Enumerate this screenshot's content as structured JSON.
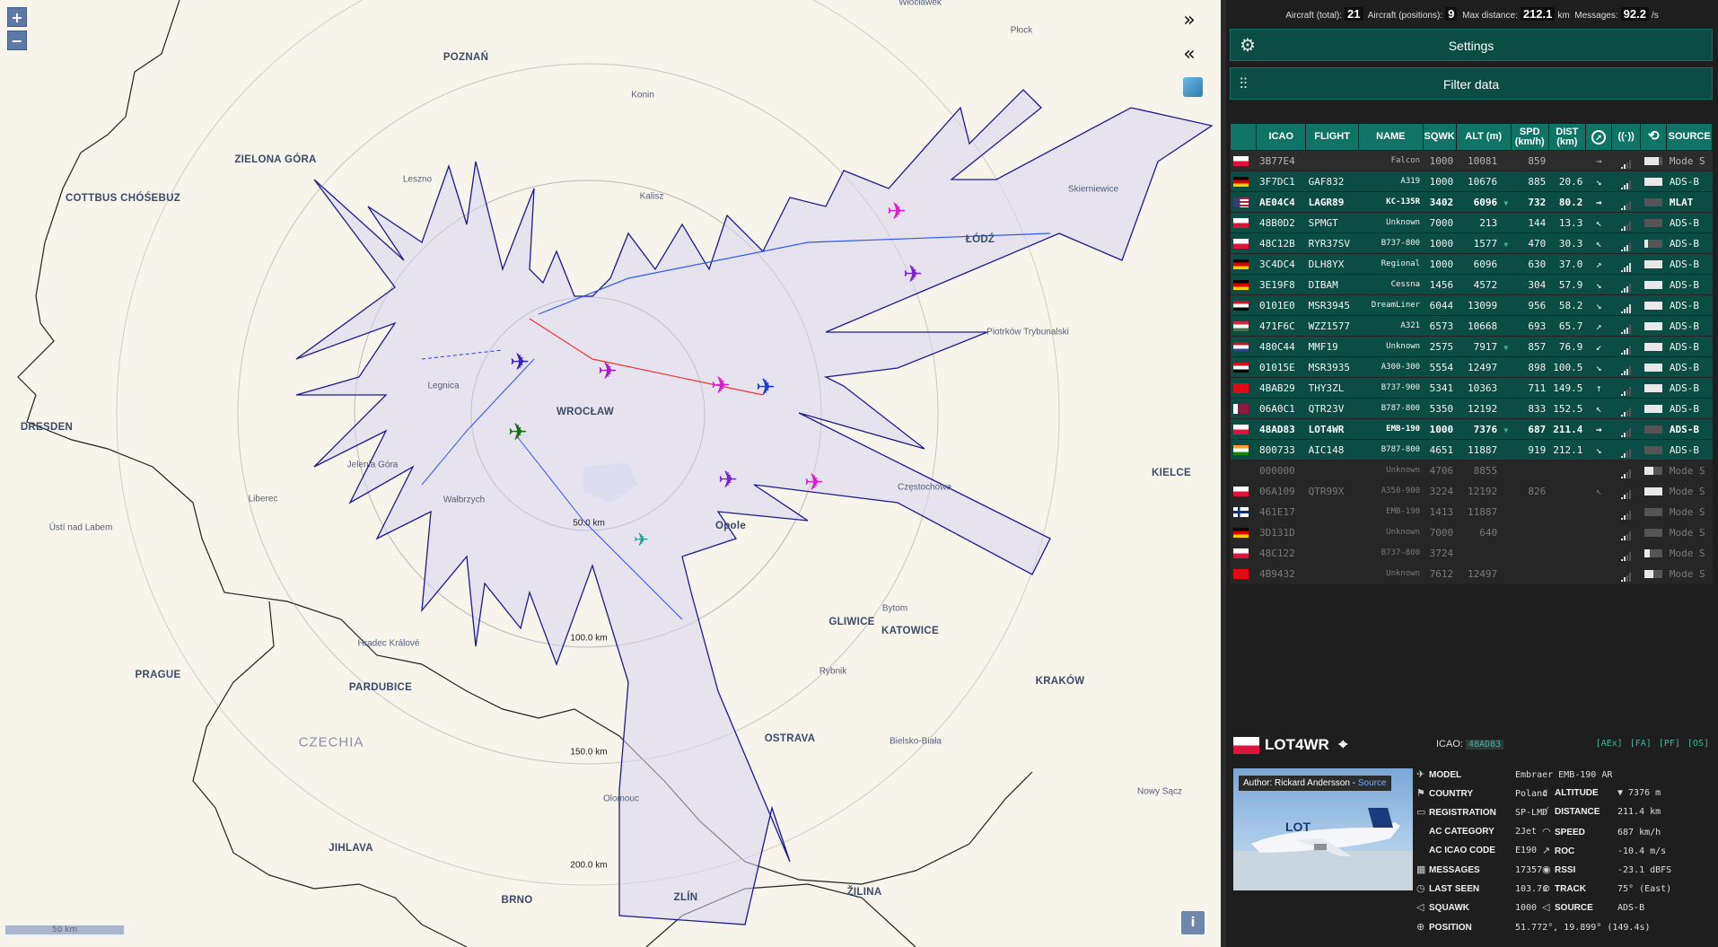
{
  "map": {
    "cities": [
      {
        "name": "POZNAŃ",
        "cls": "big"
      },
      {
        "name": "ZIELONA GÓRA",
        "cls": "big"
      },
      {
        "name": "COTTBUS CHÓŚEBUZ",
        "cls": "big"
      },
      {
        "name": "Konin",
        "cls": ""
      },
      {
        "name": "Leszno",
        "cls": ""
      },
      {
        "name": "Kalisz",
        "cls": ""
      },
      {
        "name": "Płock",
        "cls": ""
      },
      {
        "name": "Skierniewice",
        "cls": ""
      },
      {
        "name": "ŁÓDŹ",
        "cls": "big"
      },
      {
        "name": "Piotrków Trybunalski",
        "cls": ""
      },
      {
        "name": "Legnica",
        "cls": ""
      },
      {
        "name": "WROCŁAW",
        "cls": "big"
      },
      {
        "name": "DRESDEN",
        "cls": "big"
      },
      {
        "name": "Jelenia Góra",
        "cls": ""
      },
      {
        "name": "Wałbrzych",
        "cls": ""
      },
      {
        "name": "Liberec",
        "cls": ""
      },
      {
        "name": "Ústí nad Labem",
        "cls": ""
      },
      {
        "name": "Opole",
        "cls": "big"
      },
      {
        "name": "Częstochowa",
        "cls": ""
      },
      {
        "name": "KIELCE",
        "cls": "big"
      },
      {
        "name": "Bytom",
        "cls": ""
      },
      {
        "name": "GLIWICE",
        "cls": "big"
      },
      {
        "name": "KATOWICE",
        "cls": "big"
      },
      {
        "name": "Hradec Králové",
        "cls": ""
      },
      {
        "name": "PRAGUE",
        "cls": "big"
      },
      {
        "name": "PARDUBICE",
        "cls": "big"
      },
      {
        "name": "Rybnik",
        "cls": ""
      },
      {
        "name": "KRAKÓW",
        "cls": "big"
      },
      {
        "name": "CZECHIA",
        "cls": "country"
      },
      {
        "name": "OSTRAVA",
        "cls": "big"
      },
      {
        "name": "Bielsko-Biała",
        "cls": ""
      },
      {
        "name": "Olomouc",
        "cls": ""
      },
      {
        "name": "JIHLAVA",
        "cls": "big"
      },
      {
        "name": "BRNO",
        "cls": "big"
      },
      {
        "name": "ZLÍN",
        "cls": "big"
      },
      {
        "name": "ŽILINA",
        "cls": "big"
      },
      {
        "name": "Nowy Sącz",
        "cls": ""
      },
      {
        "name": "Włocławek",
        "cls": ""
      }
    ],
    "range_labels": [
      "50.0 km",
      "100.0 km",
      "150.0 km",
      "200.0 km"
    ],
    "scale_label": "50 km",
    "zoom_in": "+",
    "zoom_out": "−",
    "info": "i",
    "expand": "»",
    "collapse": "«"
  },
  "stats": {
    "total_label": "Aircraft (total):",
    "total": "21",
    "pos_label": "Aircraft (positions):",
    "pos": "9",
    "dist_label": "Max distance:",
    "dist": "212.1",
    "dist_unit": "km",
    "msg_label": "Messages:",
    "msg": "92.2",
    "msg_unit": "/s"
  },
  "buttons": {
    "settings": "Settings",
    "filter": "Filter data"
  },
  "table": {
    "headers": [
      "ICAO",
      "FLIGHT",
      "NAME",
      "SQWK",
      "ALT (m)",
      "SPD (km/h)",
      "DIST (km)",
      "SOURCE"
    ],
    "rows": [
      {
        "cls": "nopos",
        "flag": "pl",
        "icao": "3B77E4",
        "flight": "",
        "name": "Falcon",
        "sqwk": "1000",
        "alt": "10081",
        "vr": "",
        "spd": "859",
        "dist": "",
        "trk": "→",
        "sig": 2,
        "rs": 0.8,
        "src": "Mode S"
      },
      {
        "cls": "pos",
        "flag": "de",
        "icao": "3F7DC1",
        "flight": "GAF832",
        "name": "A319",
        "sqwk": "1000",
        "alt": "10676",
        "vr": "",
        "spd": "885",
        "dist": "20.6",
        "trk": "↘",
        "sig": 3,
        "rs": 1,
        "src": "ADS-B"
      },
      {
        "cls": "pos sel",
        "flag": "us",
        "icao": "AE04C4",
        "flight": "LAGR89",
        "name": "KC-135R",
        "sqwk": "3402",
        "alt": "6096",
        "vr": "▼",
        "spd": "732",
        "dist": "80.2",
        "trk": "→",
        "sig": 2,
        "rs": 0,
        "src": "MLAT"
      },
      {
        "cls": "pos",
        "flag": "pl",
        "icao": "48B0D2",
        "flight": "SPMGT",
        "name": "Unknown",
        "sqwk": "7000",
        "alt": "213",
        "vr": "",
        "spd": "144",
        "dist": "13.3",
        "trk": "↖",
        "sig": 2,
        "rs": 0,
        "src": "ADS-B"
      },
      {
        "cls": "pos",
        "flag": "pl",
        "icao": "48C12B",
        "flight": "RYR37SV",
        "name": "B737-800",
        "sqwk": "1000",
        "alt": "1577",
        "vr": "▼",
        "spd": "470",
        "dist": "30.3",
        "trk": "↖",
        "sig": 3,
        "rs": 0.2,
        "src": "ADS-B"
      },
      {
        "cls": "pos",
        "flag": "de",
        "icao": "3C4DC4",
        "flight": "DLH8YX",
        "name": "Regional",
        "sqwk": "1000",
        "alt": "6096",
        "vr": "",
        "spd": "630",
        "dist": "37.0",
        "trk": "↗",
        "sig": 4,
        "rs": 1,
        "src": "ADS-B"
      },
      {
        "cls": "pos",
        "flag": "de",
        "icao": "3E19F8",
        "flight": "DIBAM",
        "name": "Cessna",
        "sqwk": "1456",
        "alt": "4572",
        "vr": "",
        "spd": "304",
        "dist": "57.9",
        "trk": "↘",
        "sig": 3,
        "rs": 1,
        "src": "ADS-B"
      },
      {
        "cls": "pos",
        "flag": "eg",
        "icao": "0101E0",
        "flight": "MSR3945",
        "name": "DreamLiner",
        "sqwk": "6044",
        "alt": "13099",
        "vr": "",
        "spd": "956",
        "dist": "58.2",
        "trk": "↘",
        "sig": 4,
        "rs": 1,
        "src": "ADS-B"
      },
      {
        "cls": "pos",
        "flag": "hu",
        "icao": "471F6C",
        "flight": "WZZ1577",
        "name": "A321",
        "sqwk": "6573",
        "alt": "10668",
        "vr": "",
        "spd": "693",
        "dist": "65.7",
        "trk": "↗",
        "sig": 3,
        "rs": 1,
        "src": "ADS-B"
      },
      {
        "cls": "pos",
        "flag": "nl",
        "icao": "480C44",
        "flight": "MMF19",
        "name": "Unknown",
        "sqwk": "2575",
        "alt": "7917",
        "vr": "▼",
        "spd": "857",
        "dist": "76.9",
        "trk": "↙",
        "sig": 3,
        "rs": 1,
        "src": "ADS-B"
      },
      {
        "cls": "pos",
        "flag": "eg",
        "icao": "01015E",
        "flight": "MSR3935",
        "name": "A300-300",
        "sqwk": "5554",
        "alt": "12497",
        "vr": "",
        "spd": "898",
        "dist": "100.5",
        "trk": "↘",
        "sig": 3,
        "rs": 1,
        "src": "ADS-B"
      },
      {
        "cls": "pos",
        "flag": "tr",
        "icao": "4BAB29",
        "flight": "THY3ZL",
        "name": "B737-900",
        "sqwk": "5341",
        "alt": "10363",
        "vr": "",
        "spd": "711",
        "dist": "149.5",
        "trk": "↑",
        "sig": 2,
        "rs": 1,
        "src": "ADS-B"
      },
      {
        "cls": "pos",
        "flag": "qa",
        "icao": "06A0C1",
        "flight": "QTR23V",
        "name": "B787-800",
        "sqwk": "5350",
        "alt": "12192",
        "vr": "",
        "spd": "833",
        "dist": "152.5",
        "trk": "↖",
        "sig": 2,
        "rs": 1,
        "src": "ADS-B"
      },
      {
        "cls": "pos sel",
        "flag": "pl",
        "icao": "48AD83",
        "flight": "LOT4WR",
        "name": "EMB-190",
        "sqwk": "1000",
        "alt": "7376",
        "vr": "▼",
        "spd": "687",
        "dist": "211.4",
        "trk": "→",
        "sig": 2,
        "rs": 0,
        "src": "ADS-B"
      },
      {
        "cls": "pos",
        "flag": "in",
        "icao": "800733",
        "flight": "AIC148",
        "name": "B787-800",
        "sqwk": "4651",
        "alt": "11887",
        "vr": "",
        "spd": "919",
        "dist": "212.1",
        "trk": "↘",
        "sig": 2,
        "rs": 0,
        "src": "ADS-B"
      },
      {
        "cls": "stale",
        "flag": "",
        "icao": "000000",
        "flight": "",
        "name": "Unknown",
        "sqwk": "4706",
        "alt": "8855",
        "vr": "",
        "spd": "",
        "dist": "",
        "trk": "",
        "sig": 2,
        "rs": 0.5,
        "src": "Mode S"
      },
      {
        "cls": "stale",
        "flag": "pl",
        "icao": "06A109",
        "flight": "QTR99X",
        "name": "A350-900",
        "sqwk": "3224",
        "alt": "12192",
        "vr": "",
        "spd": "826",
        "dist": "",
        "trk": "↖",
        "sig": 2,
        "rs": 1,
        "src": "Mode S"
      },
      {
        "cls": "stale",
        "flag": "fi",
        "icao": "461E17",
        "flight": "",
        "name": "EMB-190",
        "sqwk": "1413",
        "alt": "11887",
        "vr": "",
        "spd": "",
        "dist": "",
        "trk": "",
        "sig": 2,
        "rs": 0,
        "src": "Mode S"
      },
      {
        "cls": "stale",
        "flag": "de",
        "icao": "3D131D",
        "flight": "",
        "name": "Unknown",
        "sqwk": "7000",
        "alt": "640",
        "vr": "",
        "spd": "",
        "dist": "",
        "trk": "",
        "sig": 2,
        "rs": 0,
        "src": "Mode S"
      },
      {
        "cls": "stale",
        "flag": "pl",
        "icao": "48C122",
        "flight": "",
        "name": "B737-800",
        "sqwk": "3724",
        "alt": "",
        "vr": "",
        "spd": "",
        "dist": "",
        "trk": "",
        "sig": 2,
        "rs": 0.3,
        "src": "Mode S"
      },
      {
        "cls": "stale",
        "flag": "tr",
        "icao": "4B9432",
        "flight": "",
        "name": "Unknown",
        "sqwk": "7612",
        "alt": "12497",
        "vr": "",
        "spd": "",
        "dist": "",
        "trk": "",
        "sig": 2,
        "rs": 0.5,
        "src": "Mode S"
      }
    ]
  },
  "detail": {
    "callsign": "LOT4WR",
    "icao_label": "ICAO:",
    "icao": "48AD83",
    "links": "[AEx] [FA] [PF] [OS]",
    "photo_author": "Author: Rickard Andersson - ",
    "photo_source": "Source",
    "left": [
      {
        "k": "MODEL",
        "v": "Embraer EMB-190 AR",
        "icon": "✈"
      },
      {
        "k": "COUNTRY",
        "v": "Poland",
        "icon": "⚑"
      },
      {
        "k": "REGISTRATION",
        "v": "SP-LMD",
        "icon": "▭"
      },
      {
        "k": "AC CATEGORY",
        "v": "2Jet",
        "icon": ""
      },
      {
        "k": "AC ICAO CODE",
        "v": "E190",
        "icon": ""
      },
      {
        "k": "MESSAGES",
        "v": "17357",
        "icon": "▦"
      },
      {
        "k": "LAST SEEN",
        "v": "103.7s",
        "icon": "◷"
      },
      {
        "k": "SQUAWK",
        "v": "1000",
        "icon": "◁"
      },
      {
        "k": "POSITION",
        "v": "51.772°, 19.899° (149.4s)",
        "icon": "⊕"
      }
    ],
    "right": [
      {
        "k": "ALTITUDE",
        "v": "▼ 7376 m",
        "icon": "↕"
      },
      {
        "k": "DISTANCE",
        "v": "211.4 km",
        "icon": "⟋"
      },
      {
        "k": "SPEED",
        "v": "687 km/h",
        "icon": "◠"
      },
      {
        "k": "ROC",
        "v": "-10.4 m/s",
        "icon": "↗"
      },
      {
        "k": "RSSI",
        "v": "-23.1 dBFS",
        "icon": "◉"
      },
      {
        "k": "TRACK",
        "v": "75° (East)",
        "icon": "⊘"
      },
      {
        "k": "SOURCE",
        "v": "ADS-B",
        "icon": "◁"
      }
    ]
  }
}
